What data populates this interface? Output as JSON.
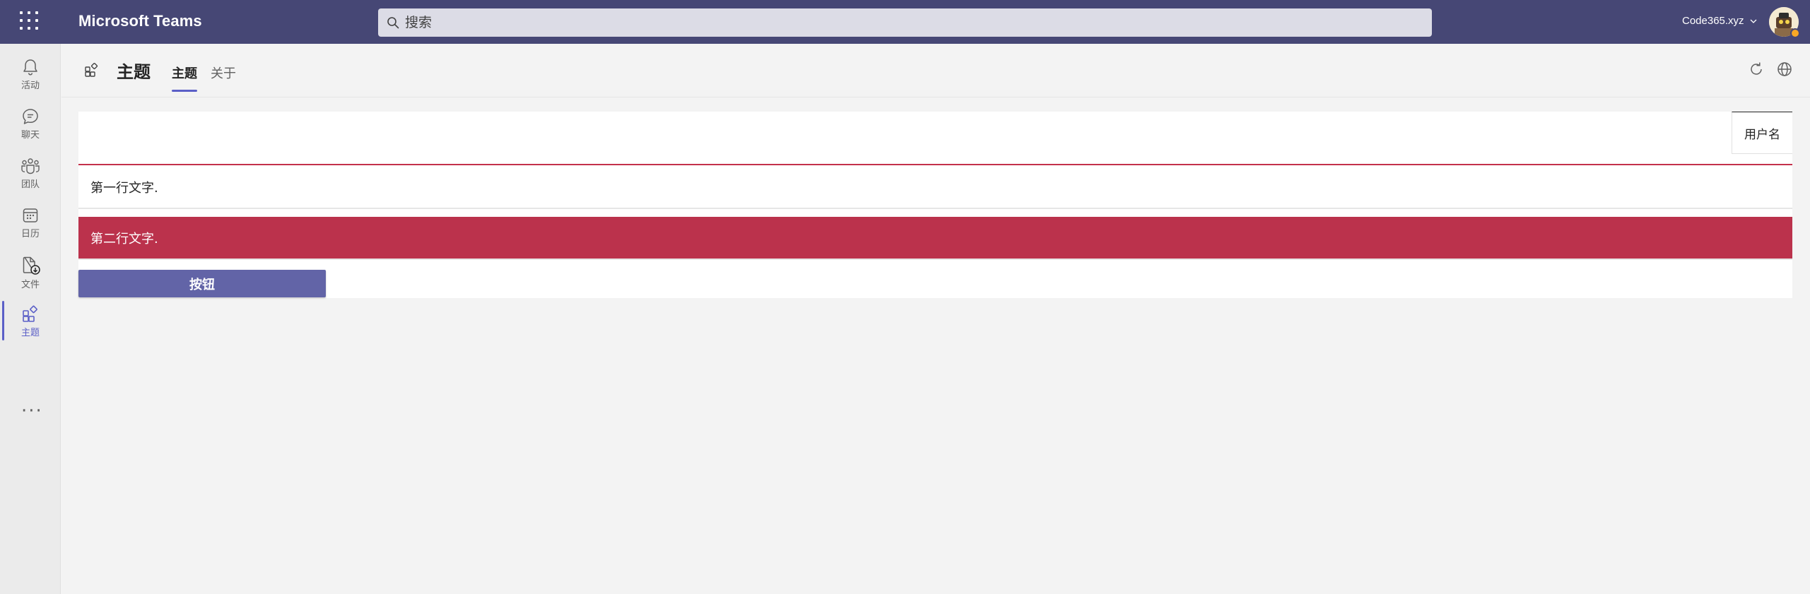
{
  "titlebar": {
    "app_name": "Microsoft Teams",
    "search_placeholder": "搜索",
    "org_name": "Code365.xyz",
    "background_color": "#464775"
  },
  "rail": {
    "items": [
      {
        "label": "活动",
        "icon": "bell-icon"
      },
      {
        "label": "聊天",
        "icon": "chat-icon"
      },
      {
        "label": "团队",
        "icon": "teams-icon"
      },
      {
        "label": "日历",
        "icon": "calendar-icon"
      },
      {
        "label": "文件",
        "icon": "file-download-icon"
      },
      {
        "label": "主题",
        "icon": "apps-icon",
        "active": true
      }
    ],
    "more": "···"
  },
  "header": {
    "title": "主题",
    "tabs": [
      {
        "label": "主题",
        "active": true
      },
      {
        "label": "关于",
        "active": false
      }
    ]
  },
  "content": {
    "username": "用户名",
    "row1_text": "第一行文字.",
    "row2_text": "第二行文字.",
    "button_label": "按钮",
    "accent_color": "#c4314b",
    "button_color": "#6264a7"
  }
}
